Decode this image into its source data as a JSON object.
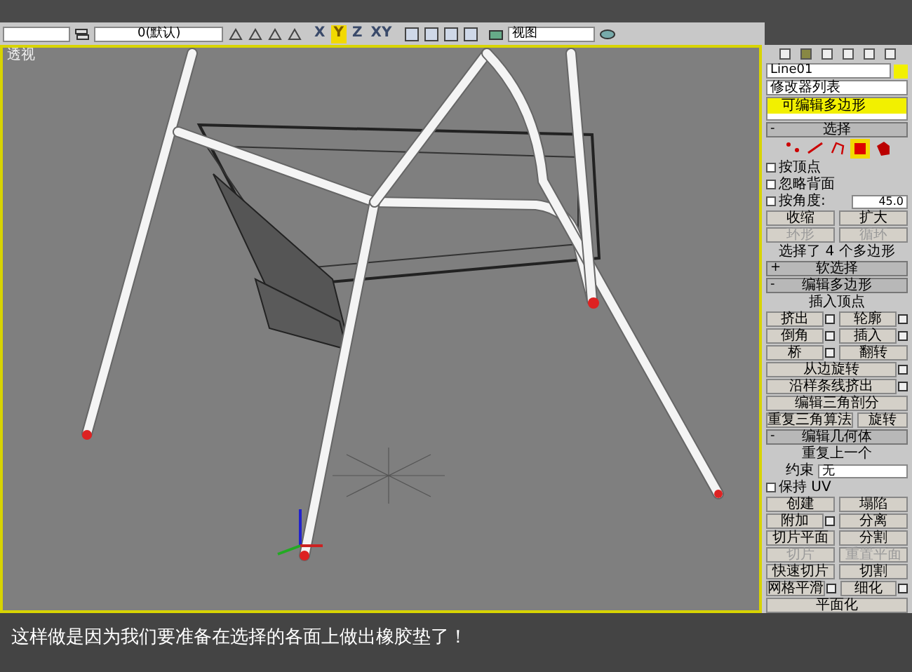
{
  "toolbar": {
    "layer_dropdown": "0(默认)",
    "axes": [
      {
        "label": "X",
        "selected": false
      },
      {
        "label": "Y",
        "selected": true
      },
      {
        "label": "Z",
        "selected": false
      },
      {
        "label": "XY",
        "selected": false
      }
    ],
    "view_dropdown": "视图"
  },
  "viewport": {
    "label": "透视"
  },
  "panel": {
    "object_name": "Line01",
    "modifier_list": "修改器列表",
    "stack": [
      {
        "label": "可编辑多边形",
        "selected": true
      }
    ],
    "rollouts": [
      {
        "sign": "-",
        "title": "选择",
        "rows": [
          {
            "kind": "subobjects",
            "items": [
              {
                "kind": "vertex",
                "selected": false
              },
              {
                "kind": "edge",
                "selected": false
              },
              {
                "kind": "border",
                "selected": false
              },
              {
                "kind": "polygon",
                "selected": true
              },
              {
                "kind": "element",
                "selected": false
              }
            ]
          },
          {
            "kind": "check",
            "label": "按顶点",
            "checked": false
          },
          {
            "kind": "check",
            "label": "忽略背面",
            "checked": false
          },
          {
            "kind": "check",
            "label": "按角度:",
            "checked": false,
            "value": "45.0"
          },
          {
            "kind": "buttons",
            "buttons": [
              {
                "label": "收缩",
                "settings": false,
                "disabled": false
              },
              {
                "label": "扩大",
                "settings": false,
                "disabled": false
              }
            ]
          },
          {
            "kind": "buttons",
            "buttons": [
              {
                "label": "环形",
                "settings": false,
                "disabled": true
              },
              {
                "label": "循环",
                "settings": false,
                "disabled": true
              }
            ]
          },
          {
            "kind": "text",
            "label": "选择了 4 个多边形"
          }
        ]
      },
      {
        "sign": "+",
        "title": "软选择"
      },
      {
        "sign": "-",
        "title": "编辑多边形",
        "rows": [
          {
            "kind": "text",
            "label": "插入顶点"
          },
          {
            "kind": "buttons",
            "buttons": [
              {
                "label": "挤出",
                "settings": true,
                "disabled": false
              },
              {
                "label": "轮廓",
                "settings": true,
                "disabled": false
              }
            ]
          },
          {
            "kind": "buttons",
            "buttons": [
              {
                "label": "倒角",
                "settings": true,
                "disabled": false
              },
              {
                "label": "插入",
                "settings": true,
                "disabled": false
              }
            ]
          },
          {
            "kind": "buttons",
            "buttons": [
              {
                "label": "桥",
                "settings": true,
                "disabled": false
              },
              {
                "label": "翻转",
                "settings": false,
                "disabled": false
              }
            ]
          },
          {
            "kind": "buttons",
            "buttons": [
              {
                "label": "从边旋转",
                "settings": true,
                "disabled": false
              }
            ]
          },
          {
            "kind": "buttons",
            "buttons": [
              {
                "label": "沿样条线挤出",
                "settings": true,
                "disabled": false
              }
            ]
          },
          {
            "kind": "buttons",
            "buttons": [
              {
                "label": "编辑三角剖分",
                "settings": false,
                "disabled": false
              }
            ]
          },
          {
            "kind": "buttons",
            "buttons": [
              {
                "label": "重复三角算法",
                "settings": false,
                "disabled": false
              },
              {
                "label": "旋转",
                "settings": false,
                "disabled": false
              }
            ]
          }
        ]
      },
      {
        "sign": "-",
        "title": "编辑几何体",
        "rows": [
          {
            "kind": "text",
            "label": "重复上一个"
          },
          {
            "kind": "dropdown",
            "label": "约束",
            "value": "无"
          },
          {
            "kind": "check",
            "label": "保持 UV",
            "checked": false
          },
          {
            "kind": "buttons",
            "buttons": [
              {
                "label": "创建",
                "settings": false,
                "disabled": false
              },
              {
                "label": "塌陷",
                "settings": false,
                "disabled": false
              }
            ]
          },
          {
            "kind": "buttons",
            "buttons": [
              {
                "label": "附加",
                "settings": true,
                "disabled": false
              },
              {
                "label": "分离",
                "settings": false,
                "disabled": false
              }
            ]
          },
          {
            "kind": "buttons",
            "buttons": [
              {
                "label": "切片平面",
                "settings": false,
                "disabled": false
              },
              {
                "label": "分割",
                "settings": false,
                "disabled": false
              }
            ]
          },
          {
            "kind": "buttons",
            "buttons": [
              {
                "label": "切片",
                "settings": false,
                "disabled": true
              },
              {
                "label": "重置平面",
                "settings": false,
                "disabled": true
              }
            ]
          },
          {
            "kind": "buttons",
            "buttons": [
              {
                "label": "快速切片",
                "settings": false,
                "disabled": false
              },
              {
                "label": "切割",
                "settings": false,
                "disabled": false
              }
            ]
          },
          {
            "kind": "buttons",
            "buttons": [
              {
                "label": "网格平滑",
                "settings": true,
                "disabled": false
              },
              {
                "label": "细化",
                "settings": true,
                "disabled": false
              }
            ]
          },
          {
            "kind": "buttons",
            "buttons": [
              {
                "label": "平面化",
                "settings": false,
                "disabled": false
              }
            ]
          }
        ]
      }
    ]
  },
  "caption": "这样做是因为我们要准备在选择的各面上做出橡胶垫了！"
}
